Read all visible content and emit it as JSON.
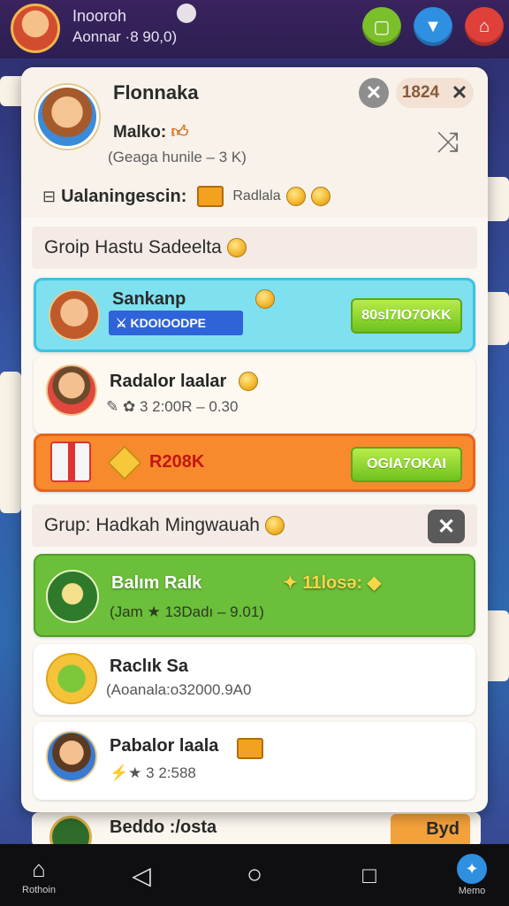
{
  "colors": {
    "cyan_card": "#7fe0f0",
    "orange_card": "#f88a2e",
    "green_card": "#6bbf3a",
    "button_green": "#6ec21e",
    "accent_red": "#e0403a"
  },
  "topbar": {
    "title": "Inooroh",
    "subtitle": "Aonnar ·8 90,0)"
  },
  "modal": {
    "title": "Flonnaka",
    "subtitle1": "Malko:",
    "subtitle2": "(Geaga hunile – 3 K)",
    "count": "1824",
    "info_label": "Ualaningescin:",
    "info_small": "Radlala"
  },
  "group1": {
    "title": "Groip  Hastu Sadeelta"
  },
  "cards": {
    "c1": {
      "name": "Sankanp",
      "tag": "KDOIOODPE",
      "button": "80sl7IO7OKK"
    },
    "c2": {
      "name": "Radalor laalar",
      "meta": "3 2:00R  –  0.30"
    },
    "c3": {
      "name": "R208K",
      "button": "OGlA7OKAI"
    },
    "c4": {
      "name": "Balım Ralk",
      "bonus": "11losə:",
      "meta": "(Jam ★ 13Dadı – 9.01)"
    },
    "c5": {
      "name": "Raclık Sa",
      "meta": "(Aoanala:o32000.9A0"
    },
    "c6": {
      "name": "Pabalor laala",
      "meta": "3 2:588"
    }
  },
  "group2": {
    "title": "Grup: Hadkah Mingwauah"
  },
  "background": {
    "bottom_card": "Beddo :/osta",
    "bottom_side": "Byd"
  },
  "nav": {
    "home": "Rothoin",
    "menu": "Memo"
  }
}
